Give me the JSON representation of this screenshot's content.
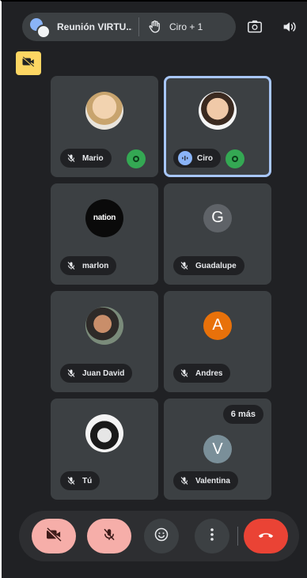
{
  "header": {
    "meeting_title": "Reunión VIRTU...",
    "raised_hands": "Ciro + 1"
  },
  "participants": [
    {
      "name": "Mario",
      "avatar": "photo-person"
    },
    {
      "name": "Ciro",
      "avatar": "photo-person",
      "speaking": true
    },
    {
      "name": "marlon",
      "avatar": "logo-nation",
      "logo_text": "nation"
    },
    {
      "name": "Guadalupe",
      "avatar": "letter",
      "initial": "G"
    },
    {
      "name": "Juan David",
      "avatar": "photo-person"
    },
    {
      "name": "Andres",
      "avatar": "letter",
      "initial": "A"
    },
    {
      "name": "Tú",
      "avatar": "photo-person"
    },
    {
      "name": "Valentina",
      "avatar": "letter",
      "initial": "V"
    }
  ],
  "more_badge": "6 más",
  "colors": {
    "background": "#202124",
    "tile": "#3c4043",
    "active_border": "#a8c7fa",
    "muted_button": "#f6aea9",
    "end_call": "#ea4335",
    "speaking_green": "#34a853",
    "camera_tag": "#fdd663",
    "avatar_G": "#5f6368",
    "avatar_A": "#e8710a",
    "avatar_V": "#7a8f99"
  },
  "icons": {
    "camera_tag": "camera-off-icon",
    "hand": "raise-hand-icon",
    "switch_camera": "switch-camera-icon",
    "speaker": "speaker-icon",
    "mic_off": "mic-off-icon",
    "emoji": "emoji-icon",
    "more": "more-vert-icon",
    "end_call": "end-call-icon"
  }
}
